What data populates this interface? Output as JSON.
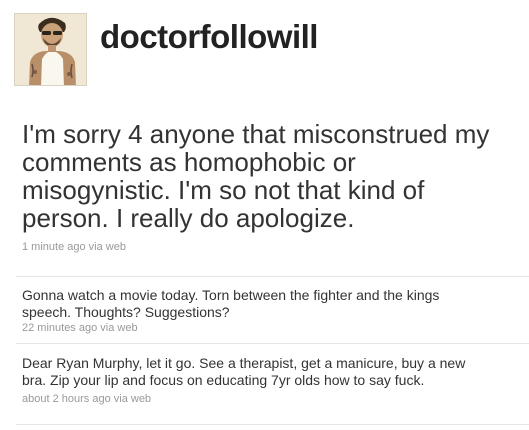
{
  "profile": {
    "username": "doctorfollowill",
    "avatar_icon": "profile-photo"
  },
  "main_status": {
    "text": "I'm sorry 4 anyone that misconstrued my comments as homophobic or misogynistic. I'm so not that kind of person. I really do apologize.",
    "time": "1 minute ago",
    "via_label": "via",
    "source": "web"
  },
  "timeline": [
    {
      "text": "Gonna watch a movie today. Torn between the fighter and the kings speech. Thoughts? Suggestions?",
      "time": "22 minutes ago",
      "via_label": "via",
      "source": "web"
    },
    {
      "text": "Dear Ryan Murphy, let it go. See a therapist, get a manicure, buy a new bra. Zip your lip and focus on educating 7yr olds how to say fuck.",
      "time": "about 2 hours ago",
      "via_label": "via",
      "source": "web"
    }
  ],
  "colors": {
    "text": "#333333",
    "meta": "#999999",
    "divider": "#e6e6e6"
  }
}
